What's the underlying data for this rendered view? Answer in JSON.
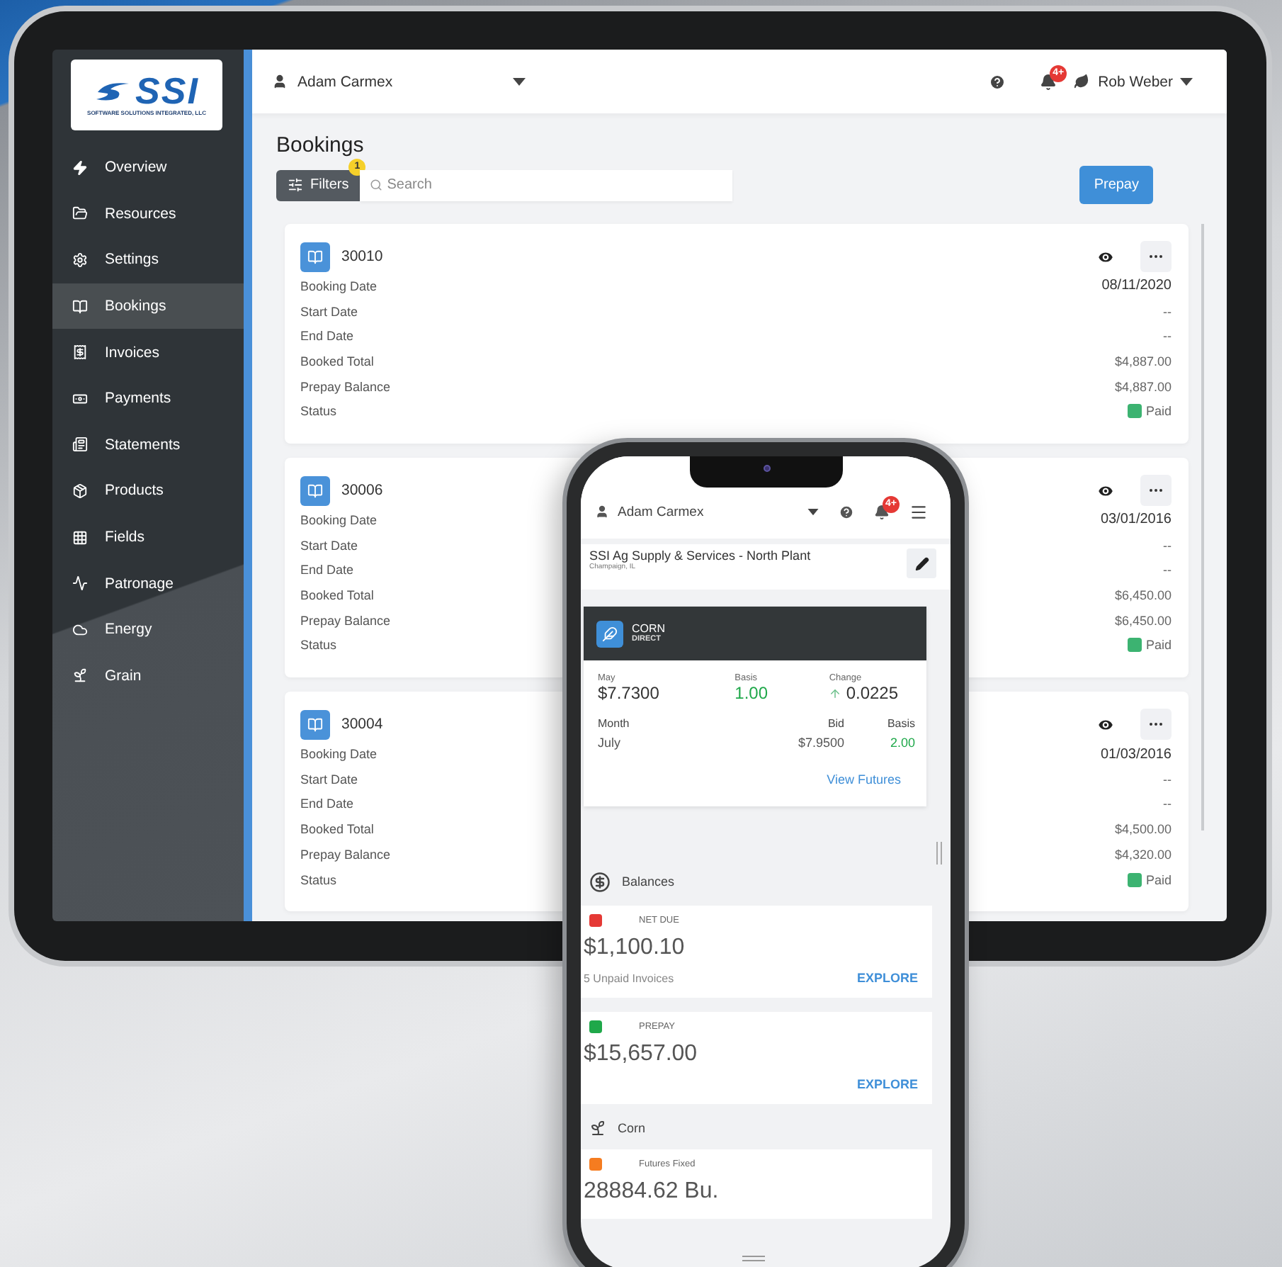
{
  "tablet": {
    "logo": {
      "mark": "SSI",
      "tagline": "SOFTWARE SOLUTIONS INTEGRATED, LLC"
    },
    "sidebar": {
      "items": [
        {
          "label": "Overview",
          "selected": false
        },
        {
          "label": "Resources",
          "selected": false
        },
        {
          "label": "Settings",
          "selected": false
        },
        {
          "label": "Bookings",
          "selected": true
        },
        {
          "label": "Invoices",
          "selected": false
        },
        {
          "label": "Payments",
          "selected": false
        },
        {
          "label": "Statements",
          "selected": false
        },
        {
          "label": "Products",
          "selected": false
        },
        {
          "label": "Fields",
          "selected": false
        },
        {
          "label": "Patronage",
          "selected": false
        },
        {
          "label": "Energy",
          "selected": false
        },
        {
          "label": "Grain",
          "selected": false
        }
      ]
    },
    "header": {
      "account": "Adam Carmex",
      "notification_badge": "4+",
      "user": "Rob Weber"
    },
    "page_title": "Bookings",
    "filters": {
      "label": "Filters",
      "badge": "1"
    },
    "search": {
      "placeholder": "Search"
    },
    "prepay_button": "Prepay",
    "bookings": [
      {
        "id": "30010",
        "fields": [
          {
            "label": "Booking Date",
            "value": "08/11/2020"
          },
          {
            "label": "Start Date",
            "value": "--"
          },
          {
            "label": "End Date",
            "value": "--"
          },
          {
            "label": "Booked Total",
            "value": "$4,887.00"
          },
          {
            "label": "Prepay Balance",
            "value": "$4,887.00"
          }
        ],
        "status": {
          "label": "Status",
          "value": "Paid",
          "color": "#3cb371"
        }
      },
      {
        "id": "30006",
        "fields": [
          {
            "label": "Booking Date",
            "value": "03/01/2016"
          },
          {
            "label": "Start Date",
            "value": "--"
          },
          {
            "label": "End Date",
            "value": "--"
          },
          {
            "label": "Booked Total",
            "value": "$6,450.00"
          },
          {
            "label": "Prepay Balance",
            "value": "$6,450.00"
          }
        ],
        "status": {
          "label": "Status",
          "value": "Paid",
          "color": "#3cb371"
        }
      },
      {
        "id": "30004",
        "fields": [
          {
            "label": "Booking Date",
            "value": "01/03/2016"
          },
          {
            "label": "Start Date",
            "value": "--"
          },
          {
            "label": "End Date",
            "value": "--"
          },
          {
            "label": "Booked Total",
            "value": "$4,500.00"
          },
          {
            "label": "Prepay Balance",
            "value": "$4,320.00"
          }
        ],
        "status": {
          "label": "Status",
          "value": "Paid",
          "color": "#3cb371"
        }
      }
    ]
  },
  "phone": {
    "header": {
      "account": "Adam Carmex",
      "notification_badge": "4+"
    },
    "location": {
      "name": "SSI Ag Supply & Services - North Plant",
      "city": "Champaign, IL"
    },
    "commodity": {
      "name": "CORN",
      "type": "DIRECT",
      "quote": {
        "month_label": "May",
        "price": "$7.7300",
        "basis_label": "Basis",
        "basis": "1.00",
        "change_label": "Change",
        "change": "0.0225"
      },
      "columns": [
        "Month",
        "Bid",
        "Basis"
      ],
      "rows": [
        [
          "July",
          "$7.9500",
          "2.00"
        ]
      ],
      "link": "View Futures"
    },
    "balances": {
      "title": "Balances",
      "items": [
        {
          "label": "NET DUE",
          "color": "#e53935",
          "amount": "$1,100.10",
          "note": "5 Unpaid Invoices",
          "action": "EXPLORE"
        },
        {
          "label": "PREPAY",
          "color": "#1fa84a",
          "amount": "$15,657.00",
          "action": "EXPLORE"
        }
      ]
    },
    "grain": {
      "title": "Corn",
      "items": [
        {
          "label": "Futures Fixed",
          "color": "#f57c20",
          "amount": "28884.62 Bu."
        }
      ]
    }
  }
}
